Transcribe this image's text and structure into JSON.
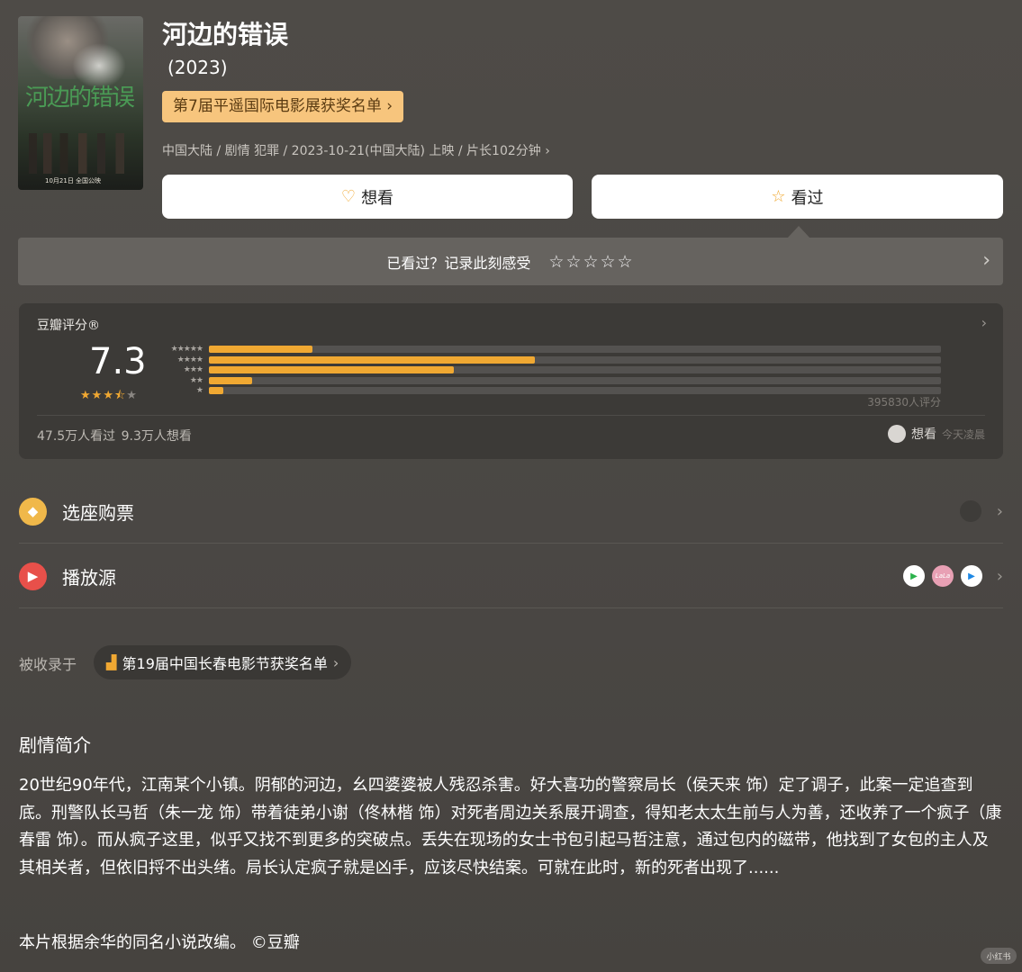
{
  "movie": {
    "title": "河边的错误",
    "year": "(2023)",
    "award_pill": "第7届平遥国际电影展获奖名单 ›",
    "meta": "中国大陆 / 剧情 犯罪 / 2023-10-21(中国大陆) 上映 / 片长102分钟 ›",
    "poster": {
      "title_text": "河边的错误",
      "date_text": "10月21日 全国公映"
    }
  },
  "actions": {
    "want_label": "想看",
    "seen_label": "看过"
  },
  "record": {
    "prompt": "已看过？记录此刻感受",
    "stars": "☆☆☆☆☆",
    "chevron": "›"
  },
  "rating": {
    "label": "豆瓣评分®",
    "score": "7.3",
    "stars_value": 3.5,
    "distribution": [
      {
        "stars": "★★★★★",
        "fraction": 0.142
      },
      {
        "stars": "★★★★",
        "fraction": 0.445
      },
      {
        "stars": "★★★",
        "fraction": 0.335
      },
      {
        "stars": "★★",
        "fraction": 0.059
      },
      {
        "stars": "★",
        "fraction": 0.02
      }
    ],
    "count": "395830人评分",
    "stats": "47.5万人看过   9.3万人想看",
    "friend_action": "想看",
    "friend_time": "今天凌晨"
  },
  "rows": [
    {
      "label": "选座购票",
      "icon": "ticket-icon",
      "color": "#f0b84a"
    },
    {
      "label": "播放源",
      "icon": "play-icon",
      "color": "#e8504a"
    }
  ],
  "sources": [
    {
      "icon": "iqiyi-icon",
      "bg": "#ffffff",
      "fg": "#2bb24c",
      "glyph": "▶"
    },
    {
      "icon": "lala-icon",
      "bg": "#e8a0b4",
      "fg": "#ffffff",
      "glyph": "LaLa"
    },
    {
      "icon": "tencent-video-icon",
      "bg": "#ffffff",
      "fg": "#1e88e5",
      "glyph": "▶"
    }
  ],
  "included": {
    "label": "被收录于",
    "pill": "第19届中国长春电影节获奖名单",
    "chevron": "›"
  },
  "synopsis": {
    "title": "剧情简介",
    "text": "20世纪90年代，江南某个小镇。阴郁的河边，幺四婆婆被人残忍杀害。好大喜功的警察局长（侯天来 饰）定了调子，此案一定追查到底。刑警队长马哲（朱一龙 饰）带着徒弟小谢（佟林楷 饰）对死者周边关系展开调查，得知老太太生前与人为善，还收养了一个疯子（康春雷 饰）。而从疯子这里，似乎又找不到更多的突破点。丢失在现场的女士书包引起马哲注意，通过包内的磁带，他找到了女包的主人及其相关者，但依旧捋不出头绪。局长认定疯子就是凶手，应该尽快结案。可就在此时，新的死者出现了......",
    "credit": "本片根据余华的同名小说改编。 ©豆瓣"
  },
  "watermark": "小红书"
}
